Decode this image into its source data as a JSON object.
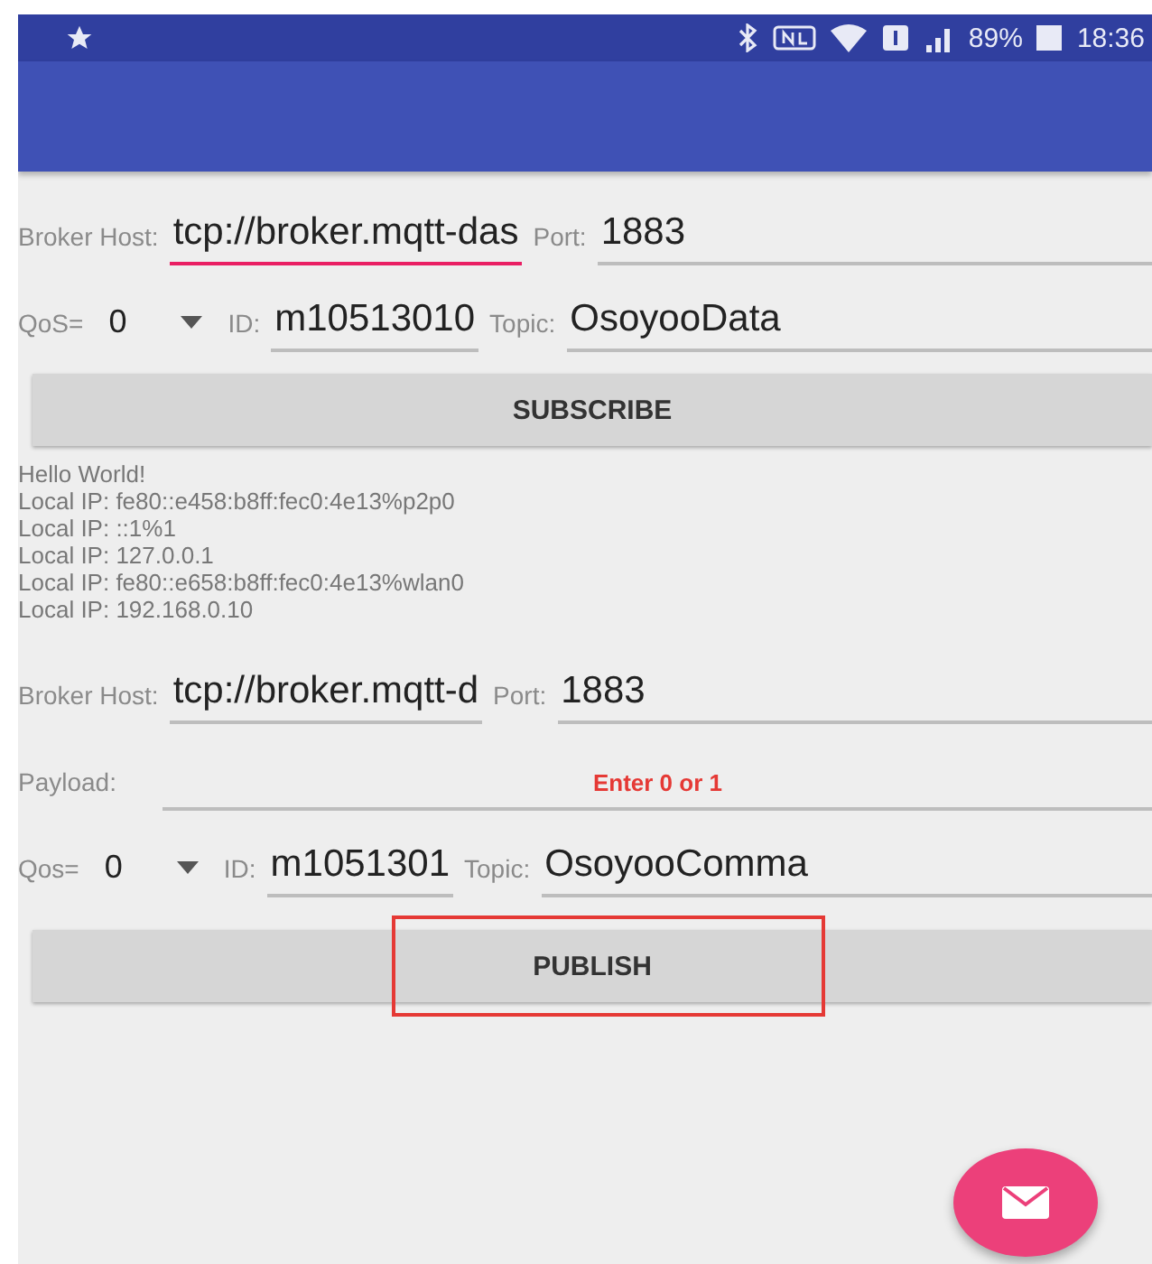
{
  "status_bar": {
    "battery": "89%",
    "time": "18:36"
  },
  "subscribe_rows": [
    [
      {
        "kind": "label",
        "text": "Broker Host:"
      },
      {
        "kind": "field",
        "value": "tcp://broker.mqtt-das",
        "focused": true
      },
      {
        "kind": "label",
        "text": "Port:"
      },
      {
        "kind": "field",
        "value": "1883",
        "focused": false
      }
    ],
    [
      {
        "kind": "label",
        "text": "QoS="
      },
      {
        "kind": "spinner",
        "value": "0"
      },
      {
        "kind": "label",
        "text": "ID:"
      },
      {
        "kind": "field",
        "value": "m10513010",
        "focused": false
      },
      {
        "kind": "label",
        "text": "Topic:"
      },
      {
        "kind": "field",
        "value": "OsoyooData",
        "focused": false
      }
    ]
  ],
  "subscribe_button": {
    "label": "SUBSCRIBE",
    "highlighted": false
  },
  "log": [
    "Hello World!",
    "Local IP: fe80::e458:b8ff:fec0:4e13%p2p0",
    "Local IP: ::1%1",
    "Local IP: 127.0.0.1",
    "Local IP: fe80::e658:b8ff:fec0:4e13%wlan0",
    "Local IP: 192.168.0.10"
  ],
  "publish_rows": [
    [
      {
        "kind": "label",
        "text": "Broker Host:"
      },
      {
        "kind": "field",
        "value": "tcp://broker.mqtt-d",
        "focused": false
      },
      {
        "kind": "label",
        "text": "Port:"
      },
      {
        "kind": "field",
        "value": "1883",
        "focused": false
      }
    ],
    [
      {
        "kind": "label",
        "text": "Payload:"
      },
      {
        "kind": "hint_field",
        "placeholder": "Enter 0 or 1"
      }
    ],
    [
      {
        "kind": "label",
        "text": "Qos="
      },
      {
        "kind": "spinner",
        "value": "0"
      },
      {
        "kind": "label",
        "text": "ID:"
      },
      {
        "kind": "field",
        "value": "m1051301",
        "focused": false
      },
      {
        "kind": "label",
        "text": "Topic:"
      },
      {
        "kind": "field",
        "value": "OsoyooComma",
        "focused": false
      }
    ]
  ],
  "publish_button": {
    "label": "PUBLISH",
    "highlighted": true
  }
}
